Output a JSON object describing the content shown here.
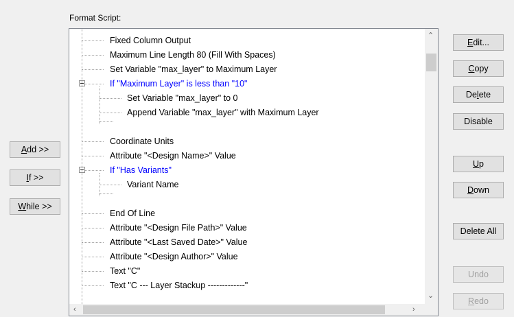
{
  "format_script_label": "Format Script:",
  "tree": {
    "rows": [
      {
        "text": "Fixed Column Output",
        "level": 0,
        "blue": false
      },
      {
        "text": "Maximum Line Length 80 (Fill With Spaces)",
        "level": 0,
        "blue": false
      },
      {
        "text": "Set Variable \"max_layer\" to Maximum Layer",
        "level": 0,
        "blue": false
      },
      {
        "text": "If  \"Maximum Layer\"  is less than  \"10\"",
        "level": 0,
        "blue": true,
        "expander": true
      },
      {
        "text": "Set Variable \"max_layer\" to 0",
        "level": 1,
        "blue": false
      },
      {
        "text": "Append Variable \"max_layer\" with Maximum Layer",
        "level": 1,
        "blue": false
      },
      {
        "text": "",
        "level": 1,
        "blue": false,
        "end": true
      },
      {
        "text": "Coordinate Units",
        "level": 0,
        "blue": false
      },
      {
        "text": "Attribute \"<Design Name>\" Value",
        "level": 0,
        "blue": false
      },
      {
        "text": "If  \"Has Variants\"",
        "level": 0,
        "blue": true,
        "expander": true
      },
      {
        "text": "Variant Name",
        "level": 1,
        "blue": false
      },
      {
        "text": "",
        "level": 1,
        "blue": false,
        "end": true
      },
      {
        "text": "End Of Line",
        "level": 0,
        "blue": false
      },
      {
        "text": "Attribute \"<Design File Path>\" Value",
        "level": 0,
        "blue": false
      },
      {
        "text": "Attribute \"<Last Saved Date>\" Value",
        "level": 0,
        "blue": false
      },
      {
        "text": "Attribute \"<Design Author>\" Value",
        "level": 0,
        "blue": false
      },
      {
        "text": "Text \"C\"",
        "level": 0,
        "blue": false
      },
      {
        "text": "Text \"C  --- Layer Stackup -------------\"",
        "level": 0,
        "blue": false
      }
    ]
  },
  "left_buttons": {
    "add": {
      "mnemonic": "A",
      "rest": "dd >>"
    },
    "if": {
      "mnemonic": "I",
      "rest": "f >>"
    },
    "while": {
      "mnemonic": "W",
      "rest": "hile >>"
    }
  },
  "right_buttons": {
    "edit": {
      "pre": "",
      "mnemonic": "E",
      "rest": "dit..."
    },
    "copy": {
      "pre": "",
      "mnemonic": "C",
      "rest": "opy"
    },
    "delete": {
      "pre": "De",
      "mnemonic": "l",
      "rest": "ete"
    },
    "disable": {
      "label": "Disable"
    },
    "up": {
      "pre": "",
      "mnemonic": "U",
      "rest": "p"
    },
    "down": {
      "pre": "",
      "mnemonic": "D",
      "rest": "own"
    },
    "delete_all": {
      "label": "Delete All"
    },
    "undo": {
      "label": "Undo",
      "disabled": true
    },
    "redo": {
      "pre": "",
      "mnemonic": "R",
      "rest": "edo",
      "disabled": true
    }
  },
  "scroll_icons": {
    "up": "chevron-up-icon",
    "down": "chevron-down-icon",
    "left": "chevron-left-icon",
    "right": "chevron-right-icon"
  }
}
